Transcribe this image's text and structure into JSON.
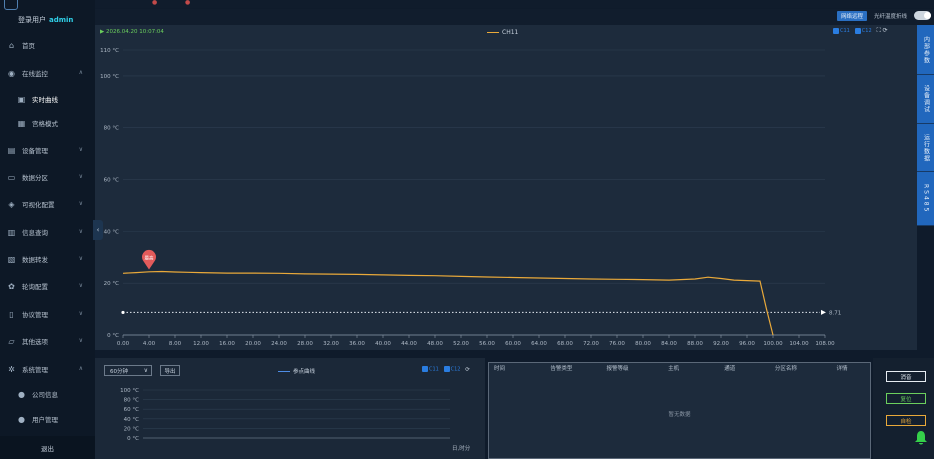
{
  "topbar": {
    "mark1": "●",
    "mark2": "●"
  },
  "sidebar": {
    "login_label": "登录用户",
    "login_user": "admin",
    "items": [
      {
        "label": "首页",
        "icon": "home-icon"
      },
      {
        "label": "在线监控",
        "icon": "eye-icon"
      },
      {
        "label": "实时曲线",
        "icon": "line-chart-icon"
      },
      {
        "label": "宫格模式",
        "icon": "grid-icon"
      },
      {
        "label": "设备管理",
        "icon": "device-icon"
      },
      {
        "label": "数据分区",
        "icon": "monitor-icon"
      },
      {
        "label": "可视化配置",
        "icon": "layers-icon"
      },
      {
        "label": "信息查询",
        "icon": "document-icon"
      },
      {
        "label": "数据转发",
        "icon": "forward-icon"
      },
      {
        "label": "轮询配置",
        "icon": "gear-icon"
      },
      {
        "label": "协议管理",
        "icon": "file-icon"
      },
      {
        "label": "其他选项",
        "icon": "folder-icon"
      },
      {
        "label": "系统管理",
        "icon": "settings-icon"
      },
      {
        "label": "公司信息",
        "icon": "user-icon"
      },
      {
        "label": "用户管理",
        "icon": "user-icon"
      }
    ],
    "logout": "退出"
  },
  "header": {
    "net_button": "网络远程",
    "toggle_label": "光纤温度折线",
    "toggle_on": false
  },
  "chart_panel": {
    "timestamp": "▶ 2026.04.20 10:07:04",
    "legend": "CH11",
    "controls": {
      "check1": "C11",
      "check2": "C12",
      "icons": "⛶ ⟳"
    },
    "collapse": "‹"
  },
  "right_tabs": [
    "内部参数",
    "设备调试",
    "运行数据",
    "RS485"
  ],
  "chart_data": {
    "type": "line",
    "series": [
      {
        "name": "CH11",
        "color": "#e9a93a",
        "x": [
          0,
          2,
          4,
          6,
          8,
          10,
          12,
          16,
          20,
          24,
          28,
          32,
          36,
          40,
          44,
          48,
          52,
          56,
          60,
          64,
          68,
          72,
          76,
          80,
          84,
          88,
          90,
          92,
          94,
          96,
          98,
          99,
          100
        ],
        "y": [
          23.8,
          24.1,
          24.4,
          24.5,
          24.3,
          24.2,
          24.1,
          23.9,
          23.9,
          23.8,
          23.6,
          23.5,
          23.4,
          23.2,
          23.0,
          22.9,
          22.6,
          22.4,
          22.2,
          22.0,
          21.8,
          21.6,
          21.5,
          21.4,
          21.2,
          21.6,
          22.3,
          21.8,
          21.2,
          21.0,
          20.8,
          10,
          0
        ]
      }
    ],
    "marker": {
      "label": "最高",
      "x": 4,
      "y": 24.5
    },
    "reference_line": {
      "y": 8.71,
      "label": "8.71"
    },
    "xlim": [
      0,
      108
    ],
    "x_ticks": [
      "0.00",
      "4.00",
      "8.00",
      "12.00",
      "16.00",
      "20.00",
      "24.00",
      "28.00",
      "32.00",
      "36.00",
      "40.00",
      "44.00",
      "48.00",
      "52.00",
      "56.00",
      "60.00",
      "64.00",
      "68.00",
      "72.00",
      "76.00",
      "80.00",
      "84.00",
      "88.00",
      "92.00",
      "96.00",
      "100.00",
      "104.00",
      "108.00"
    ],
    "ylim": [
      0,
      110
    ],
    "y_ticks": [
      "0 °C",
      "20 °C",
      "40 °C",
      "60 °C",
      "80 °C",
      "100 °C",
      "110 °C"
    ],
    "grid": true,
    "legend_position": "top-center"
  },
  "bottom_left": {
    "select_value": "60分钟",
    "export_button": "导出",
    "legend": "参点曲线",
    "controls": {
      "check1": "C11",
      "check2": "C12",
      "icons": "⟳"
    },
    "y_ticks": [
      "100 °C",
      "80 °C",
      "60 °C",
      "40 °C",
      "20 °C",
      "0 °C"
    ],
    "x_label": "日,时分"
  },
  "alarm_table": {
    "columns": [
      "时间",
      "告警类型",
      "报警等级",
      "主机",
      "通道",
      "分区名称",
      "详情"
    ],
    "empty_message": "暂无数据"
  },
  "side_buttons": {
    "b1": {
      "label": "消音",
      "color": "#e6ecf2"
    },
    "b2": {
      "label": "复位",
      "color": "#6bcf5d"
    },
    "b3": {
      "label": "自检",
      "color": "#e9a93a"
    }
  },
  "bell_color": "#35d04a"
}
